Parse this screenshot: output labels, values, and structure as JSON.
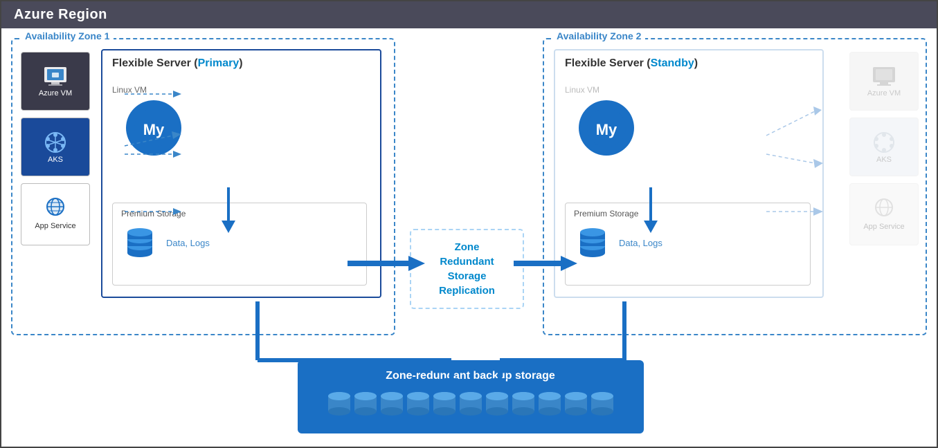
{
  "header": {
    "title": "Azure Region"
  },
  "az1": {
    "label": "Availability Zone 1",
    "clients": [
      {
        "name": "Azure VM",
        "type": "dark"
      },
      {
        "name": "AKS",
        "type": "blue"
      },
      {
        "name": "App Service",
        "type": "light"
      }
    ],
    "server": {
      "title": "Flexible Server (",
      "mode": "Primary",
      "mode_label": "Primary",
      "linux_vm": "Linux VM",
      "storage_label": "Premium Storage",
      "data_logs": "Data, Logs"
    }
  },
  "az2": {
    "label": "Availability Zone 2",
    "clients": [
      {
        "name": "Azure VM",
        "type": "faded"
      },
      {
        "name": "AKS",
        "type": "faded"
      },
      {
        "name": "App Service",
        "type": "faded"
      }
    ],
    "server": {
      "title": "Flexible Server (",
      "mode": "Standby",
      "linux_vm": "Linux VM",
      "storage_label": "Premium Storage",
      "data_logs": "Data, Logs"
    }
  },
  "zrs": {
    "line1": "Zone",
    "line2": "Redundant",
    "line3": "Storage",
    "line4": "Replication"
  },
  "backup": {
    "title": "Zone-redundant backup storage"
  }
}
